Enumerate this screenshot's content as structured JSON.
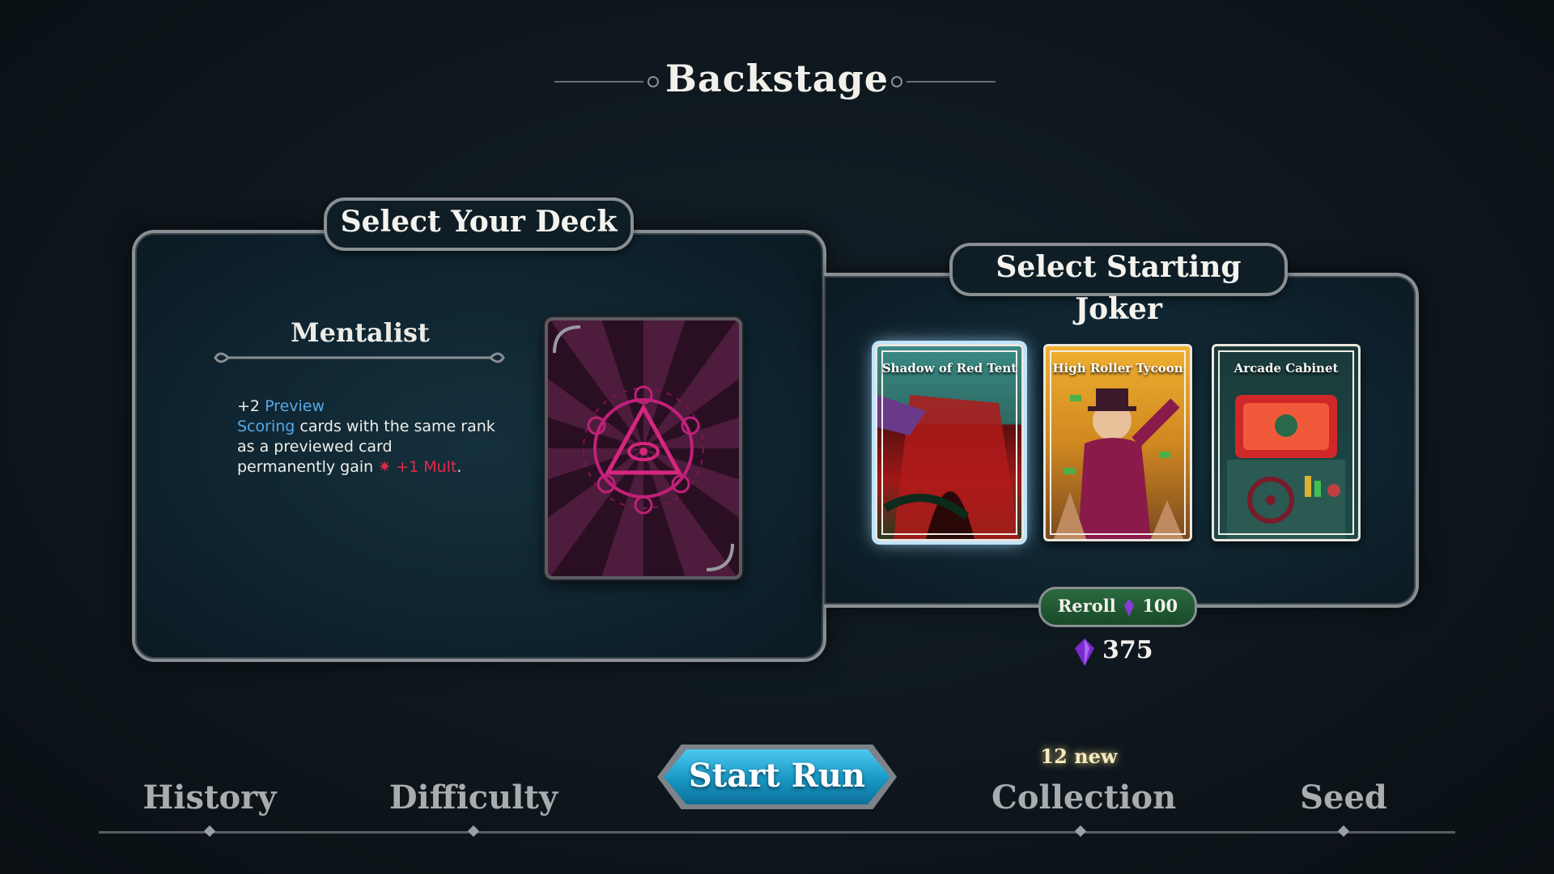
{
  "header": {
    "title": "Backstage"
  },
  "deck_panel": {
    "tab_label": "Select Your Deck",
    "deck_name": "Mentalist",
    "description": {
      "line1_prefix": "+2 ",
      "line1_keyword": "Preview",
      "line2_keyword": "Scoring",
      "line2_rest": " cards with the same rank",
      "line3": "as a previewed card",
      "line4_prefix": "permanently gain ",
      "line4_icon": "burst-icon",
      "line4_keyword": " +1 Mult",
      "line4_suffix": "."
    }
  },
  "joker_panel": {
    "tab_label": "Select Starting Joker",
    "jokers": [
      {
        "name": "Shadow of Red Tent",
        "selected": true
      },
      {
        "name": "High Roller Tycoon",
        "selected": false
      },
      {
        "name": "Arcade Cabinet",
        "selected": false
      }
    ],
    "reroll": {
      "label": "Reroll",
      "cost": "100",
      "icon": "purple-crystal-icon"
    },
    "currency": {
      "value": "375",
      "icon": "purple-crystal-icon"
    }
  },
  "bottom_nav": {
    "items": [
      "History",
      "Difficulty",
      "Start Run",
      "Collection",
      "Seed"
    ],
    "collection_badge": "12 new"
  },
  "colors": {
    "accent_blue": "#1798c4",
    "keyword_blue": "#58a8e8",
    "keyword_red": "#e3294a",
    "reroll_green": "#2a6a3e",
    "deck_magenta": "#c0207a"
  }
}
